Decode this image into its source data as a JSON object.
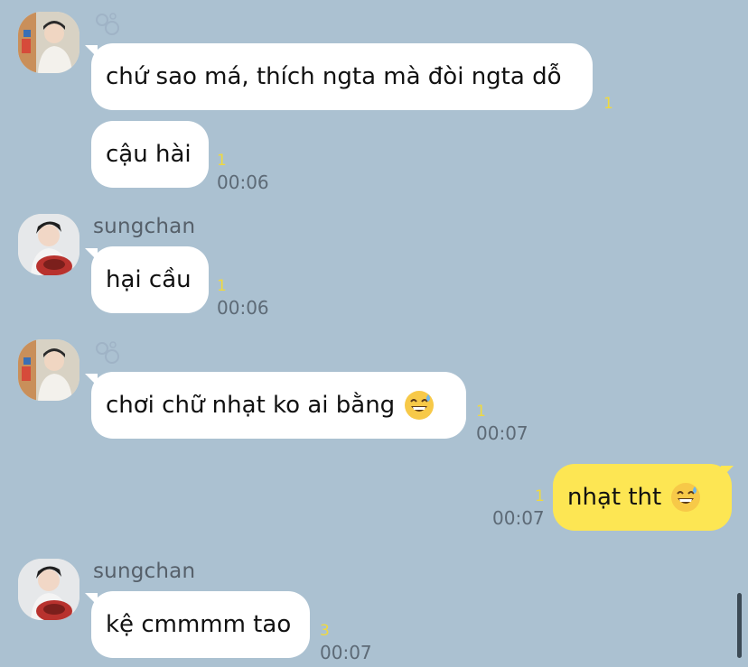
{
  "messages": {
    "m1": {
      "text": "chứ sao má, thích ngta mà đòi ngta dỗ",
      "unread": "1"
    },
    "m2": {
      "text": "cậu hài",
      "unread": "1",
      "time": "00:06"
    },
    "m3": {
      "sender": "sungchan",
      "text": "hại cầu",
      "unread": "1",
      "time": "00:06"
    },
    "m4": {
      "text": "chơi chữ nhạt ko ai bằng",
      "unread": "1",
      "time": "00:07"
    },
    "m5": {
      "text": "nhạt tht",
      "unread": "1",
      "time": "00:07"
    },
    "m6": {
      "sender": "sungchan",
      "text": "kệ cmmmm tao",
      "unread": "3",
      "time": "00:07"
    }
  },
  "colors": {
    "background": "#abc1d1",
    "incoming_bubble": "#ffffff",
    "outgoing_bubble": "#fde653",
    "unread_count": "#f0d93e"
  },
  "icons": {
    "emoji": "grinning-face-with-sweat-emoji",
    "status": "bubbles-icon"
  }
}
